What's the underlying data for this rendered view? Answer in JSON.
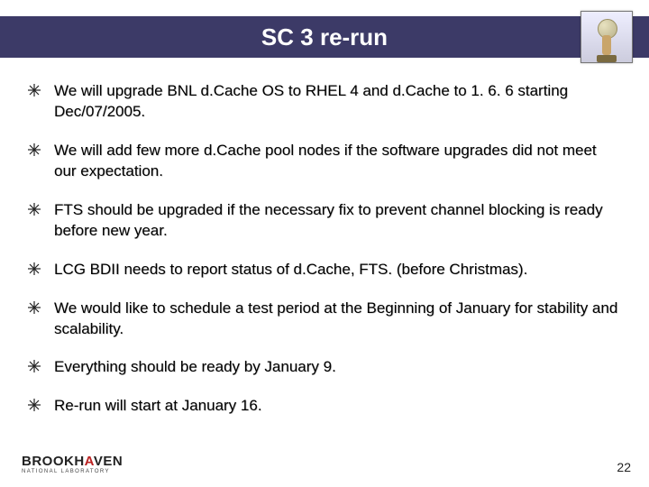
{
  "title": "SC 3 re-run",
  "bullets": [
    "We will upgrade BNL d.Cache OS to RHEL 4 and d.Cache to 1. 6. 6 starting Dec/07/2005.",
    "We will add few more d.Cache pool nodes if the software upgrades did not meet our expectation.",
    "FTS should be upgraded if the necessary fix to prevent channel blocking is ready before new year.",
    "LCG BDII needs to report status of d.Cache, FTS. (before Christmas).",
    "We would like to schedule a test period at the Beginning of January for stability and scalability.",
    "Everything should be ready by January 9.",
    "Re-run will start at January 16."
  ],
  "footer": {
    "brand_main": "BROOKH",
    "brand_accent": "A",
    "brand_rest": "VEN",
    "brand_sub": "NATIONAL LABORATORY"
  },
  "page_number": "22"
}
